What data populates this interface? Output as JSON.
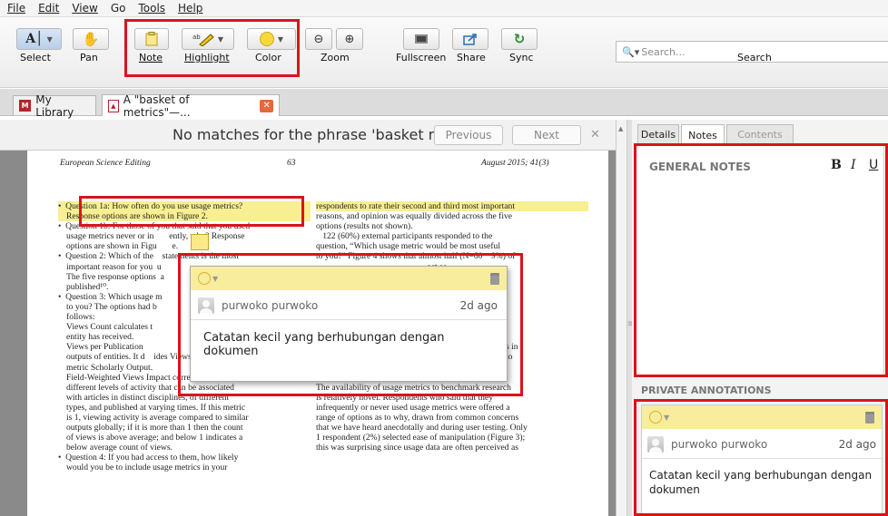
{
  "menu": {
    "file": "File",
    "edit": "Edit",
    "view": "View",
    "go": "Go",
    "tools": "Tools",
    "help": "Help"
  },
  "toolbar": {
    "select": "Select",
    "pan": "Pan",
    "note": "Note",
    "highlight": "Highlight",
    "color": "Color",
    "zoom": "Zoom",
    "fullscreen": "Fullscreen",
    "share": "Share",
    "sync": "Sync",
    "search": "Search",
    "search_placeholder": "Search...",
    "accent": "#d9141b",
    "highlight_color": "#f7d93c"
  },
  "tabs": {
    "library": "My Library",
    "document": "A \"basket of metrics\"—..."
  },
  "find": {
    "message": "No matches for the phrase 'basket met'",
    "previous": "Previous",
    "next": "Next"
  },
  "document": {
    "journal": "European Science Editing",
    "page": "63",
    "date": "August 2015; 41(3)",
    "left_lines": [
      "Question 1a: How often do you use usage metrics?",
      "Response options are shown in Figure 2.",
      "Question 1b: For those of you that said that you used",
      "usage metrics never or in       ently, why? Response",
      "options are shown in Figu       e.",
      "Question 2: Which of the    statements is the most",
      "important reason for you  u",
      "The five response options  a",
      "published¹⁰.",
      "Question 3: Which usage m",
      "to you? The options had b",
      "follows:",
      "Views Count calculates t",
      "entity has received.",
      "Views per Publication",
      "outputs of entities. It d    ides Views Count by the",
      "metric Scholarly Output.",
      "Field-Weighted Views Impact corrects for the",
      "different levels of activity that can be associated",
      "with articles in distinct disciplines, of different",
      "types, and published at varying times. If this metric",
      "is 1, viewing activity is average compared to similar",
      "outputs globally; if it is more than 1 then the count",
      "of views is above average; and below 1 indicates a",
      "below average count of views.",
      "Question 4: If you had access to them, how likely",
      "would you be to include usage metrics in your"
    ],
    "right_lines": [
      "respondents to rate their second and third most important",
      "reasons, and opinion was equally divided across the five",
      "options (results not shown).",
      "   122 (60%) external participants responded to the",
      "question, “Which usage metric would be most useful",
      "to you?” Figure 4 shows that almost half (N=60    9%) of",
      "                                                   act as",
      "                                                   r third",
      "                                                   a sixth",
      "",
      "                                                   xternal",
      "                                                   e access",
      "                                                   e metrics",
      "                                                   1; 95%)",
      "                                                   N=63;",
      "51%) or very likely (N=54; 44%) to use usage me   rics in",
      "their assessments of research merit, if they had access to",
      "them (results not shown).",
      "",
      "Discussion",
      "The availability of usage metrics to benchmark research",
      "is relatively novel. Respondents who said that they",
      "infrequently or never used usage metrics were offered a",
      "range of options as to why, drawn from common concerns",
      "that we have heard anecdotally and during user testing. Only",
      "1 respondent (2%) selected ease of manipulation (Figure 3);",
      "this was surprising since usage data are often perceived as"
    ]
  },
  "popup_note": {
    "author": "purwoko purwoko",
    "time": "2d ago",
    "text": "Catatan kecil yang berhubungan dengan dokumen"
  },
  "right_panel": {
    "tabs": {
      "details": "Details",
      "notes": "Notes",
      "contents": "Contents"
    },
    "general_notes": "GENERAL NOTES",
    "bold": "B",
    "italic": "I",
    "underline": "U",
    "private_annotations": "PRIVATE ANNOTATIONS",
    "annotation": {
      "author": "purwoko purwoko",
      "time": "2d ago",
      "text": "Catatan kecil yang berhubungan dengan dokumen"
    }
  }
}
